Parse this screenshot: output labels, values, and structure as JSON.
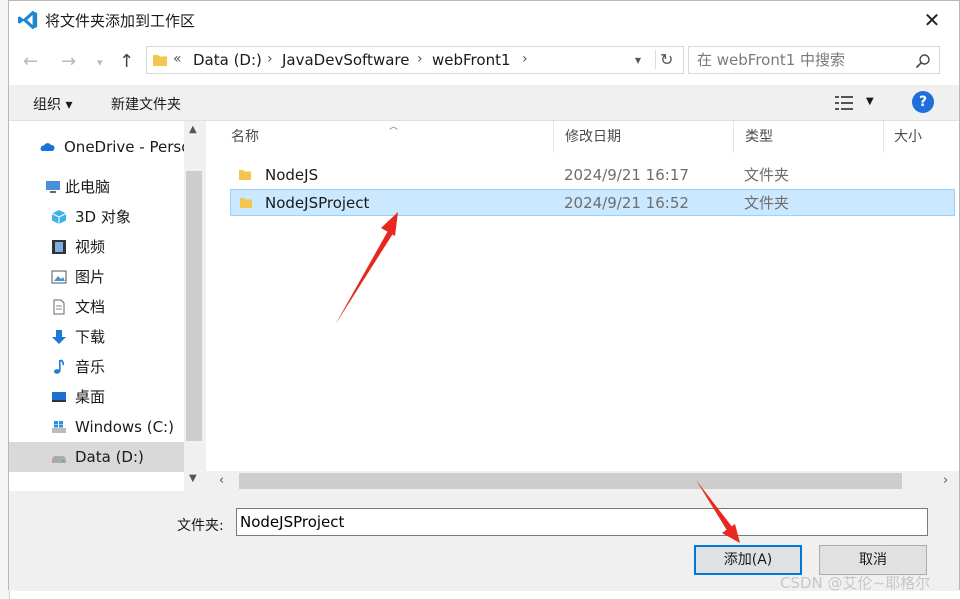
{
  "window": {
    "title": "将文件夹添加到工作区",
    "close_glyph": "✕"
  },
  "address": {
    "crumbs": [
      "Data (D:)",
      "JavaDevSoftware",
      "webFront1"
    ],
    "overflow": "«",
    "search_placeholder": "在 webFront1 中搜索"
  },
  "toolbar": {
    "organize": "组织 ▾",
    "new_folder": "新建文件夹",
    "help": "?"
  },
  "nav": {
    "items": [
      {
        "label": "OneDrive - Personal"
      },
      {
        "label": "此电脑"
      },
      {
        "label": "3D 对象"
      },
      {
        "label": "视频"
      },
      {
        "label": "图片"
      },
      {
        "label": "文档"
      },
      {
        "label": "下载"
      },
      {
        "label": "音乐"
      },
      {
        "label": "桌面"
      },
      {
        "label": "Windows (C:)"
      },
      {
        "label": "Data (D:)"
      }
    ],
    "selected": "Data (D:)"
  },
  "list": {
    "columns": [
      "名称",
      "修改日期",
      "类型",
      "大小"
    ],
    "rows": [
      {
        "name": "NodeJS",
        "date": "2024/9/21 16:17",
        "type": "文件夹",
        "selected": false
      },
      {
        "name": "NodeJSProject",
        "date": "2024/9/21 16:52",
        "type": "文件夹",
        "selected": true
      }
    ]
  },
  "footer": {
    "folder_label": "文件夹:",
    "folder_value": "NodeJSProject",
    "add_button": "添加(A)",
    "cancel_button": "取消"
  },
  "watermark": "CSDN @艾伦~耶格尔",
  "colors": {
    "accent": "#0078d7",
    "selection": "#cce8ff",
    "annotation": "#e8281e"
  }
}
